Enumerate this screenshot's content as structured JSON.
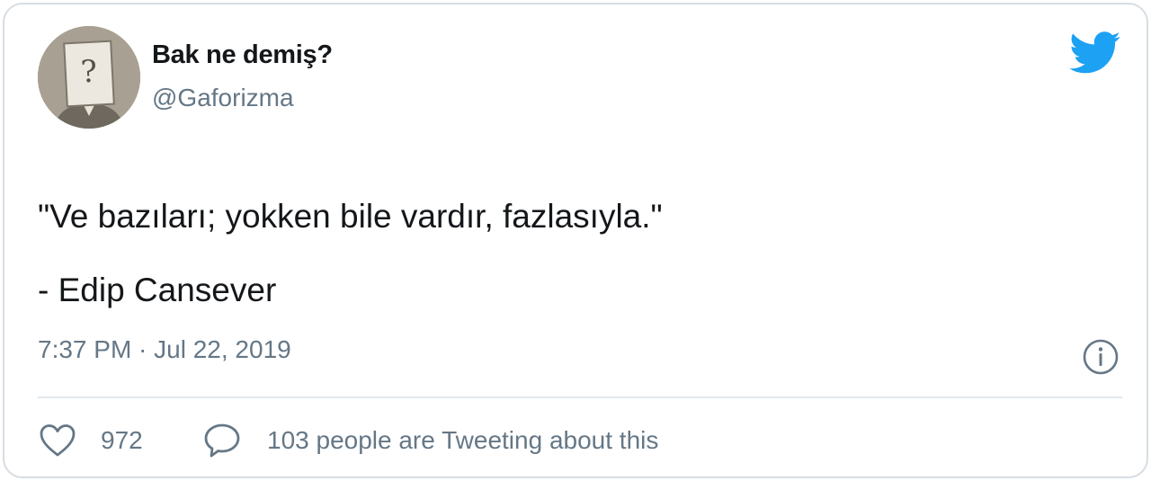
{
  "author": {
    "display_name": "Bak ne demiş?",
    "handle": "@Gaforizma",
    "avatar_icon": "question-mark-box-head"
  },
  "tweet": {
    "quote_line": "\"Ve bazıları; yokken bile vardır, fazlasıyla.\"",
    "attribution": "- Edip Cansever",
    "timestamp": "7:37 PM · Jul 22, 2019"
  },
  "actions": {
    "like_count": "972",
    "reply_text": "103 people are Tweeting about this"
  },
  "icons": {
    "brand": "twitter-bird-icon",
    "info": "info-icon",
    "like": "heart-icon",
    "reply": "speech-bubble-icon"
  },
  "colors": {
    "brand": "#1da1f2",
    "text": "#14171a",
    "secondary": "#657786",
    "border": "#d6dde3"
  }
}
